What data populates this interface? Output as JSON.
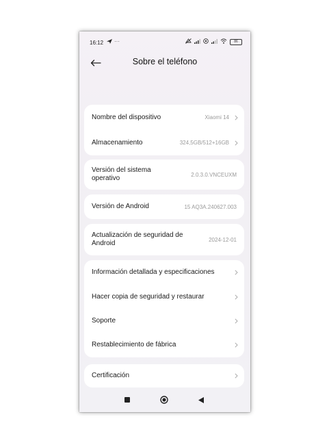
{
  "status_bar": {
    "time": "16:12",
    "dots": "···",
    "battery": "86"
  },
  "header": {
    "title": "Sobre el teléfono"
  },
  "rows": {
    "device_name": {
      "label": "Nombre del dispositivo",
      "value": "Xiaomi 14"
    },
    "storage": {
      "label": "Almacenamiento",
      "value": "324,5GB/512+16GB"
    },
    "os_version": {
      "label": "Versión del sistema operativo",
      "value": "2.0.3.0.VNCEUXM"
    },
    "android_version": {
      "label": "Versión de Android",
      "value": "15 AQ3A.240627.003"
    },
    "security_update": {
      "label": "Actualización de seguridad de Android",
      "value": "2024-12-01"
    },
    "detailed_info": {
      "label": "Información detallada y especificaciones"
    },
    "backup": {
      "label": "Hacer copia de seguridad y restaurar"
    },
    "support": {
      "label": "Soporte"
    },
    "factory_reset": {
      "label": "Restablecimiento de fábrica"
    },
    "certification": {
      "label": "Certificación"
    }
  },
  "icons": {
    "back": "arrow-left-icon",
    "chevron": "chevron-right-icon",
    "nav_recents": "square-icon",
    "nav_home": "circle-icon",
    "nav_back": "triangle-left-icon"
  }
}
